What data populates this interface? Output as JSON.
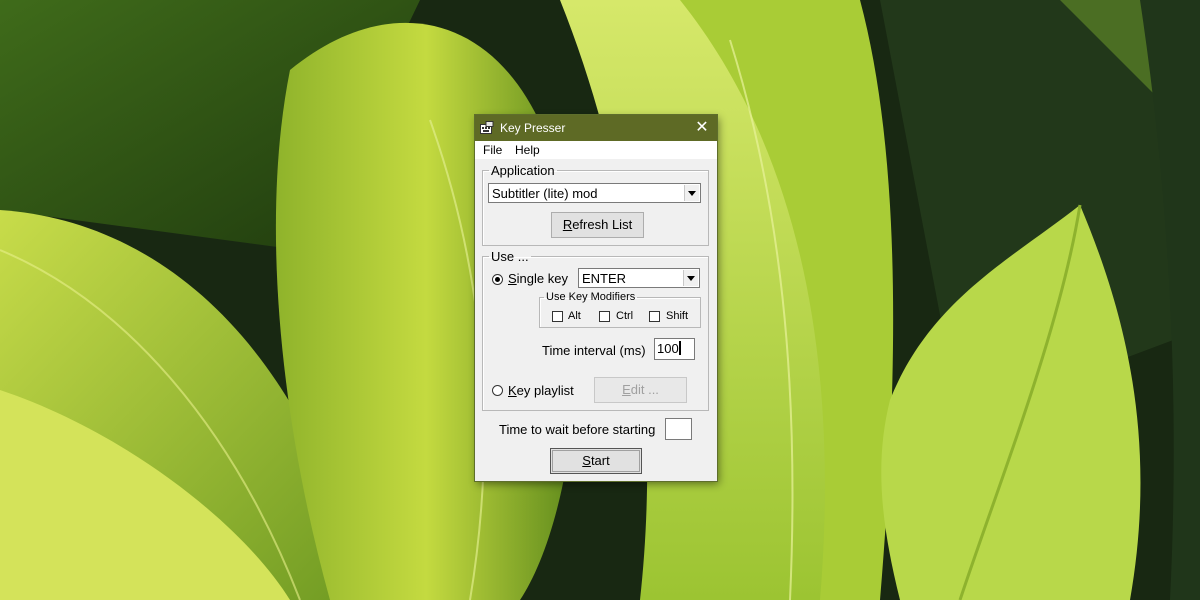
{
  "window": {
    "title": "Key Presser",
    "close_glyph": "✕",
    "icon": "app-icon"
  },
  "menu": {
    "file": "File",
    "help": "Help"
  },
  "application": {
    "legend": "Application",
    "selected_app": "Subtitler (lite) mod",
    "refresh_label_u": "R",
    "refresh_label_rest": "efresh List"
  },
  "use": {
    "legend": "Use ...",
    "single_key_u": "S",
    "single_key_rest": "ingle key",
    "selected_key": "ENTER",
    "modifiers_legend": "Use Key Modifiers",
    "alt": "Alt",
    "ctrl": "Ctrl",
    "shift": "Shift",
    "interval_label": "Time interval (ms)",
    "interval_value": "100",
    "playlist_u": "K",
    "playlist_rest": "ey playlist",
    "edit_label_u": "E",
    "edit_label_rest": "dit ..."
  },
  "wait": {
    "label": "Time to wait before starting",
    "value": ""
  },
  "start": {
    "label_u": "S",
    "label_rest": "tart"
  },
  "state": {
    "mode": "single-key",
    "alt": false,
    "ctrl": false,
    "shift": false
  },
  "colors": {
    "titlebar": "#5e6a25",
    "window_bg": "#f0f0f0",
    "leaf_light": "#b9d23a",
    "leaf_dark": "#1b2a10"
  }
}
